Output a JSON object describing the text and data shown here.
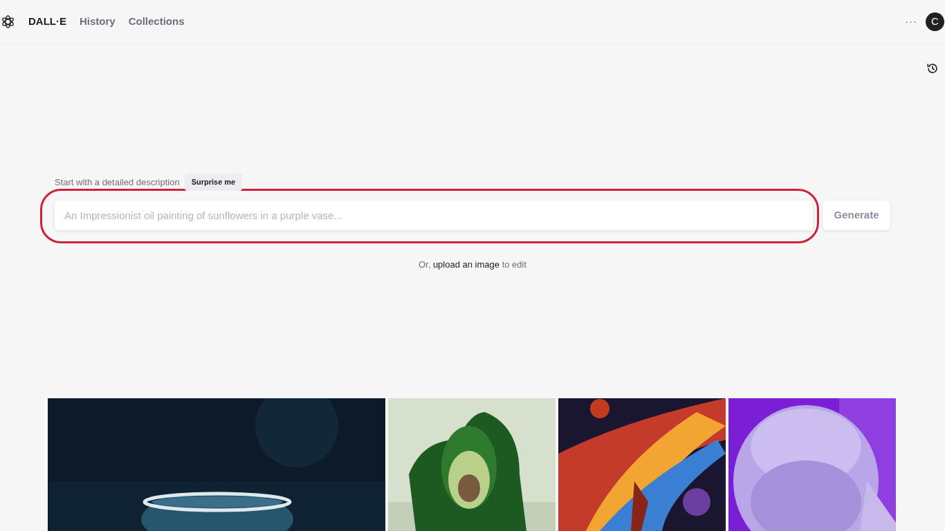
{
  "nav": {
    "brand": "DALL·E",
    "links": [
      {
        "label": "History"
      },
      {
        "label": "Collections"
      }
    ],
    "more": "···",
    "avatar": "C"
  },
  "prompt": {
    "label": "Start with a detailed description",
    "surprise": "Surprise me",
    "placeholder": "An Impressionist oil painting of sunflowers in a purple vase...",
    "button": "Generate",
    "highlighted": true
  },
  "upload": {
    "prefix": "Or,",
    "link": "upload an image",
    "suffix": "to edit"
  }
}
